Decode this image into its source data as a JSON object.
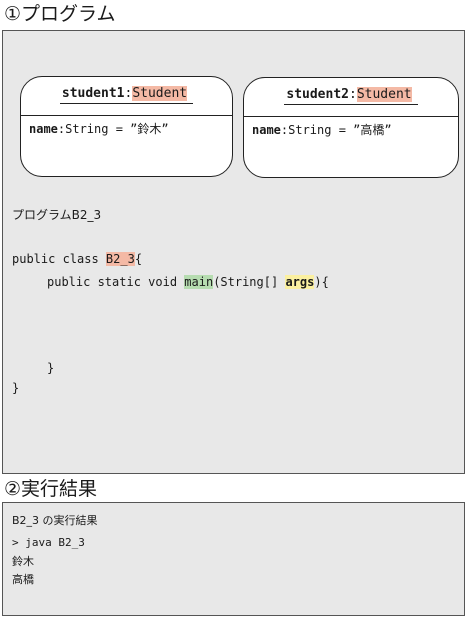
{
  "headings": {
    "program": "①プログラム",
    "result": "②実行結果"
  },
  "objects": [
    {
      "var": "student1",
      "colon": ":",
      "class": "Student",
      "attr_name": "name",
      "attr_rest": ":String = ”鈴木”"
    },
    {
      "var": "student2",
      "colon": ":",
      "class": "Student",
      "attr_name": "name",
      "attr_rest": ":String = ”高橋”"
    }
  ],
  "program": {
    "title": "プログラムB2_3",
    "line1_prefix": "public class ",
    "line1_class": "B2_3",
    "line1_suffix": "{",
    "line2_prefix": "public static void ",
    "line2_method": "main",
    "line2_mid": "(String[] ",
    "line2_args": "args",
    "line2_suffix": "){",
    "line3": "}",
    "line4": "}"
  },
  "result": {
    "title": "B2_3 の実行結果",
    "command": "> java B2_3",
    "output": [
      "鈴木",
      "高橋"
    ]
  },
  "colors": {
    "class_highlight": "#f4b9a5",
    "method_highlight": "#b6dcb0",
    "args_highlight": "#fbf0a0",
    "panel_bg": "#e8e8e8"
  }
}
